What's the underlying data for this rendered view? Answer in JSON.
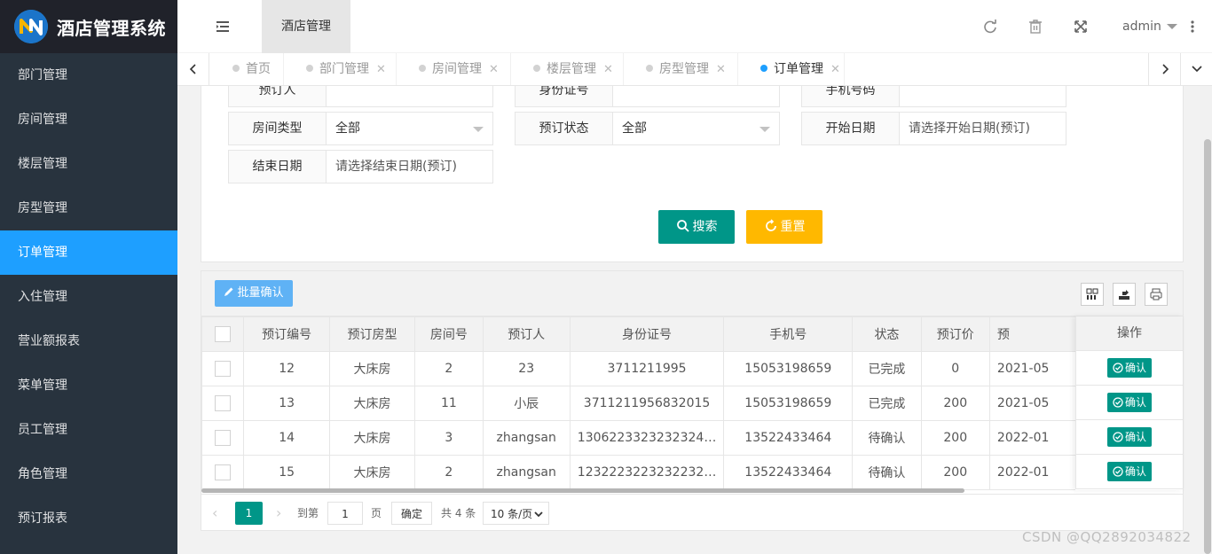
{
  "app": {
    "title": "酒店管理系统"
  },
  "sidebar": {
    "items": [
      {
        "label": "部门管理"
      },
      {
        "label": "房间管理"
      },
      {
        "label": "楼层管理"
      },
      {
        "label": "房型管理"
      },
      {
        "label": "订单管理",
        "active": true
      },
      {
        "label": "入住管理"
      },
      {
        "label": "营业额报表"
      },
      {
        "label": "菜单管理"
      },
      {
        "label": "员工管理"
      },
      {
        "label": "角色管理"
      },
      {
        "label": "预订报表"
      }
    ]
  },
  "header": {
    "tab": "酒店管理",
    "user": "admin",
    "icons": [
      "refresh-icon",
      "trash-icon",
      "fullscreen-icon",
      "more-icon"
    ]
  },
  "tabs": [
    {
      "label": "首页",
      "closable": false
    },
    {
      "label": "部门管理",
      "closable": true
    },
    {
      "label": "房间管理",
      "closable": true
    },
    {
      "label": "楼层管理",
      "closable": true
    },
    {
      "label": "房型管理",
      "closable": true
    },
    {
      "label": "订单管理",
      "closable": true,
      "active": true
    }
  ],
  "search": {
    "fields": {
      "booker": {
        "label": "预订人",
        "value": ""
      },
      "idcard": {
        "label": "身份证号",
        "value": ""
      },
      "phone": {
        "label": "手机号码",
        "value": ""
      },
      "roomtype": {
        "label": "房间类型",
        "value": "全部"
      },
      "status": {
        "label": "预订状态",
        "value": "全部"
      },
      "start": {
        "label": "开始日期",
        "placeholder": "请选择开始日期(预订)"
      },
      "end": {
        "label": "结束日期",
        "placeholder": "请选择结束日期(预订)"
      }
    },
    "search_label": "搜索",
    "reset_label": "重置"
  },
  "toolbar": {
    "batch_label": "批量确认"
  },
  "table": {
    "columns": [
      "预订编号",
      "预订房型",
      "房间号",
      "预订人",
      "身份证号",
      "手机号",
      "状态",
      "预订价",
      "预"
    ],
    "action_header": "操作",
    "action_label": "确认",
    "rows": [
      [
        "12",
        "大床房",
        "2",
        "23",
        "3711211995",
        "15053198659",
        "已完成",
        "0",
        "2021-05"
      ],
      [
        "13",
        "大床房",
        "11",
        "小辰",
        "3711211956832015",
        "15053198659",
        "已完成",
        "200",
        "2021-05"
      ],
      [
        "14",
        "大床房",
        "3",
        "zhangsan",
        "1306223323232324…",
        "13522433464",
        "待确认",
        "200",
        "2022-01"
      ],
      [
        "15",
        "大床房",
        "2",
        "zhangsan",
        "1232223223232232…",
        "13522433464",
        "待确认",
        "200",
        "2022-01"
      ]
    ]
  },
  "pager": {
    "current": "1",
    "goto_label": "到第",
    "goto_value": "1",
    "unit": "页",
    "ok_label": "确定",
    "total": "共 4 条",
    "page_size": "10 条/页"
  },
  "watermark": "CSDN @QQ2892034822",
  "colors": {
    "primary": "#1e9fff",
    "teal": "#009688",
    "warm": "#ffb800",
    "sidebar": "#28333e"
  }
}
